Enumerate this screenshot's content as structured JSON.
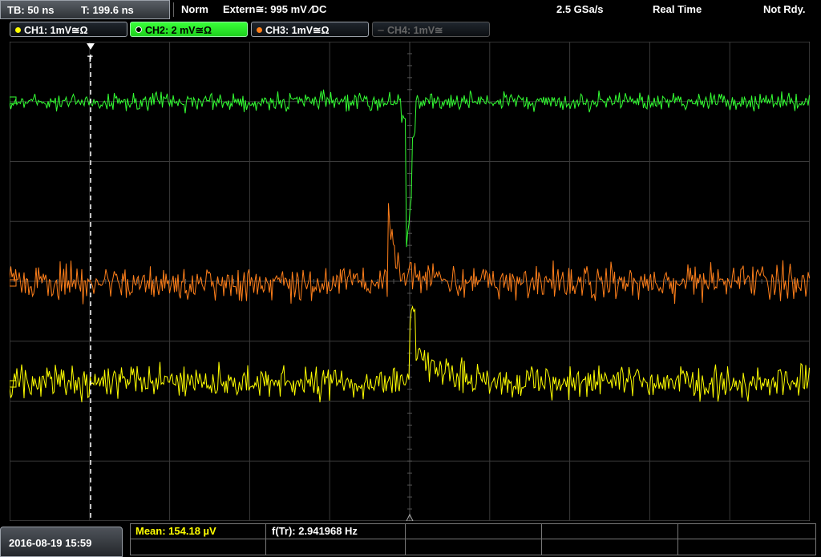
{
  "header": {
    "timebase": "TB: 50 ns",
    "trigger_time": "T: 199.6 ns",
    "trigger_mode": "Norm",
    "trigger_source": "Extern≅: 995 mV ⁄DC",
    "sample_rate": "2.5 GSa/s",
    "acq_mode": "Real Time",
    "status": "Not Rdy."
  },
  "channels": [
    {
      "label": "CH1: 1mV≅Ω",
      "color": "#ffff00",
      "active": false,
      "enabled": true
    },
    {
      "label": "CH2: 2 mV≅Ω",
      "color": "#33ff33",
      "active": true,
      "enabled": true
    },
    {
      "label": "CH3: 1mV≅Ω",
      "color": "#ff7f1a",
      "active": false,
      "enabled": true
    },
    {
      "label": "CH4: 1mV≅",
      "color": "#666666",
      "active": false,
      "enabled": false
    }
  ],
  "trigger_marker": "T",
  "footer": {
    "datetime": "2016-08-19 15:59",
    "meas1": "Mean: 154.18 µV",
    "meas2": "f(Tr): 2.941968 Hz"
  },
  "colors": {
    "ch1": "#ffff00",
    "ch2": "#33ff33",
    "ch3": "#ff7f1a",
    "grid": "#3a3a3a"
  }
}
